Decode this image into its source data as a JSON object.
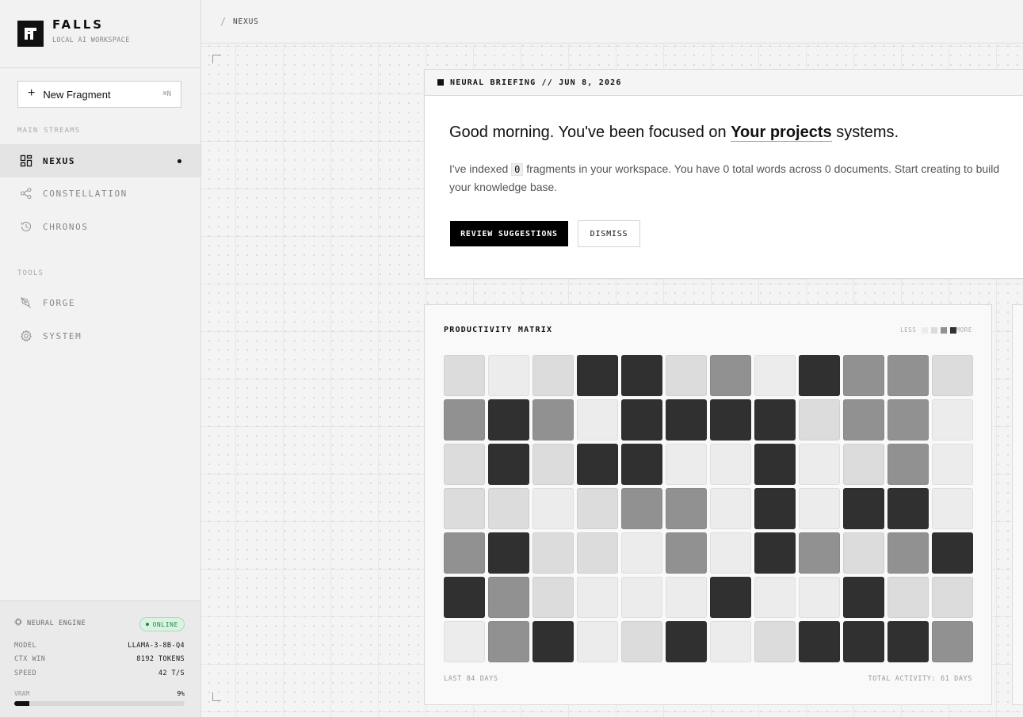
{
  "app": {
    "name": "FALLS",
    "subtitle": "LOCAL AI WORKSPACE"
  },
  "sidebar": {
    "new_button": {
      "label": "New Fragment",
      "shortcut": "⌘N"
    },
    "main_label": "MAIN STREAMS",
    "main_items": [
      {
        "label": "NEXUS",
        "icon": "grid-icon",
        "active": true
      },
      {
        "label": "CONSTELLATION",
        "icon": "share-nodes-icon",
        "active": false
      },
      {
        "label": "CHRONOS",
        "icon": "history-icon",
        "active": false
      }
    ],
    "tools_label": "TOOLS",
    "tool_items": [
      {
        "label": "FORGE",
        "icon": "pen-tool-icon"
      },
      {
        "label": "SYSTEM",
        "icon": "gear-icon"
      }
    ],
    "engine": {
      "title": "NEURAL ENGINE",
      "status": "ONLINE",
      "status_color": "#1f8a46",
      "rows": [
        {
          "key": "MODEL",
          "value": "LLAMA-3-8B-Q4"
        },
        {
          "key": "CTX WIN",
          "value": "8192 TOKENS"
        },
        {
          "key": "SPEED",
          "value": "42 T/S"
        }
      ],
      "vram_label": "VRAM",
      "vram_text": "9%",
      "vram_fraction": 0.09
    }
  },
  "header": {
    "breadcrumb": "NEXUS"
  },
  "briefing": {
    "header": "NEURAL BRIEFING // JUN 8, 2026",
    "greeting_pre": "Good morning. You've been focused on ",
    "greeting_highlight": "Your projects",
    "greeting_post": " systems.",
    "summary_pre": "I've indexed ",
    "summary_count": "0",
    "summary_post": " fragments in your workspace. You have 0 total words across 0 documents. Start creating to build your knowledge base.",
    "primary_label": "REVIEW SUGGESTIONS",
    "secondary_label": "DISMISS"
  },
  "matrix": {
    "title": "PRODUCTIVITY MATRIX",
    "legend_less": "LESS",
    "legend_more": "MORE",
    "footer_left": "LAST 84 DAYS",
    "footer_right": "TOTAL ACTIVITY: 61 DAYS",
    "levels_colors": [
      "#ececec",
      "#dcdcdc",
      "#919191",
      "#303030"
    ],
    "rows": [
      [
        1,
        0,
        1,
        3,
        3,
        1,
        2,
        0,
        3,
        2,
        2,
        1
      ],
      [
        2,
        3,
        2,
        0,
        3,
        3,
        3,
        3,
        1,
        2,
        2,
        0
      ],
      [
        1,
        3,
        1,
        3,
        3,
        0,
        0,
        3,
        0,
        1,
        2,
        0
      ],
      [
        1,
        1,
        0,
        1,
        2,
        2,
        0,
        3,
        0,
        3,
        3,
        0
      ],
      [
        2,
        3,
        1,
        1,
        0,
        2,
        0,
        3,
        2,
        1,
        2,
        3
      ],
      [
        3,
        2,
        1,
        0,
        0,
        0,
        3,
        0,
        0,
        3,
        1,
        1
      ],
      [
        0,
        2,
        3,
        0,
        1,
        3,
        0,
        1,
        3,
        3,
        3,
        2
      ]
    ]
  }
}
